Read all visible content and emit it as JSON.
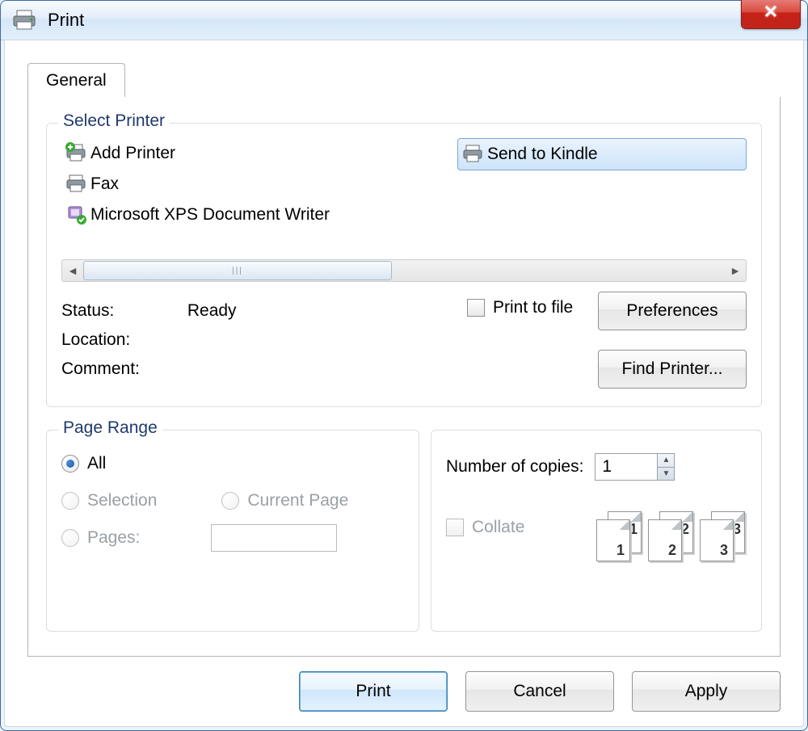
{
  "window": {
    "title": "Print"
  },
  "tabs": [
    {
      "label": "General"
    }
  ],
  "select_printer": {
    "legend": "Select Printer",
    "printers_left": [
      {
        "label": "Add Printer"
      },
      {
        "label": "Fax"
      },
      {
        "label": "Microsoft XPS Document Writer"
      }
    ],
    "printers_right": [
      {
        "label": "Send to Kindle",
        "selected": true
      }
    ],
    "status_label": "Status:",
    "status_value": "Ready",
    "location_label": "Location:",
    "location_value": "",
    "comment_label": "Comment:",
    "comment_value": "",
    "print_to_file_label": "Print to file",
    "preferences_label": "Preferences",
    "find_printer_label": "Find Printer..."
  },
  "page_range": {
    "legend": "Page Range",
    "all_label": "All",
    "selection_label": "Selection",
    "current_page_label": "Current Page",
    "pages_label": "Pages:",
    "pages_value": ""
  },
  "copies": {
    "copies_label": "Number of copies:",
    "copies_value": "1",
    "collate_label": "Collate",
    "collate_pages": [
      "1",
      "1",
      "2",
      "2",
      "3",
      "3"
    ]
  },
  "buttons": {
    "print": "Print",
    "cancel": "Cancel",
    "apply": "Apply"
  }
}
